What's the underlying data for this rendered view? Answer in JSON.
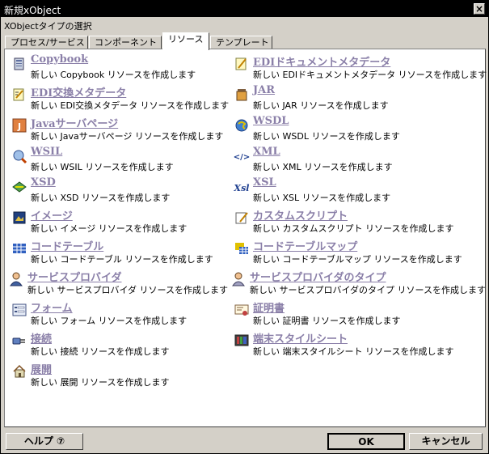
{
  "window": {
    "title": "新規xObject",
    "close_label": "×",
    "subtitle": "XObjectタイプの選択"
  },
  "tabs": [
    {
      "label": "プロセス/サービス"
    },
    {
      "label": "コンポーネント"
    },
    {
      "label": "リソース"
    },
    {
      "label": "テンプレート"
    }
  ],
  "active_tab": "リソース",
  "items": [
    {
      "name": "Copybook",
      "desc": "新しい Copybook リソースを作成します",
      "icon": "copybook-icon"
    },
    {
      "name": "EDIドキュメントメタデータ",
      "desc": "新しい EDIドキュメントメタデータ リソースを作成します",
      "icon": "edi-document-icon"
    },
    {
      "name": "EDI交換メタデータ",
      "desc": "新しい EDI交換メタデータ リソースを作成します",
      "icon": "edi-exchange-icon"
    },
    {
      "name": "JAR",
      "desc": "新しい JAR リソースを作成します",
      "icon": "jar-icon"
    },
    {
      "name": "Javaサーバページ",
      "desc": "新しい Javaサーバページ リソースを作成します",
      "icon": "jsp-icon"
    },
    {
      "name": "WSDL",
      "desc": "新しい WSDL リソースを作成します",
      "icon": "wsdl-icon"
    },
    {
      "name": "WSIL",
      "desc": "新しい WSIL リソースを作成します",
      "icon": "wsil-icon"
    },
    {
      "name": "XML",
      "desc": "新しい XML リソースを作成します",
      "icon": "xml-icon"
    },
    {
      "name": "XSD",
      "desc": "新しい XSD リソースを作成します",
      "icon": "xsd-icon"
    },
    {
      "name": "XSL",
      "desc": "新しい XSL リソースを作成します",
      "icon": "xsl-icon"
    },
    {
      "name": "イメージ",
      "desc": "新しい イメージ リソースを作成します",
      "icon": "image-icon"
    },
    {
      "name": "カスタムスクリプト",
      "desc": "新しい カスタムスクリプト リソースを作成します",
      "icon": "custom-script-icon"
    },
    {
      "name": "コードテーブル",
      "desc": "新しい コードテーブル リソースを作成します",
      "icon": "code-table-icon"
    },
    {
      "name": "コードテーブルマップ",
      "desc": "新しい コードテーブルマップ リソースを作成します",
      "icon": "code-table-map-icon"
    },
    {
      "name": "サービスプロバイダ",
      "desc": "新しい サービスプロバイダ リソースを作成します",
      "icon": "service-provider-icon"
    },
    {
      "name": "サービスプロバイダのタイプ",
      "desc": "新しい サービスプロバイダのタイプ リソースを作成します",
      "icon": "service-provider-type-icon"
    },
    {
      "name": "フォーム",
      "desc": "新しい フォーム リソースを作成します",
      "icon": "form-icon"
    },
    {
      "name": "証明書",
      "desc": "新しい 証明書 リソースを作成します",
      "icon": "certificate-icon"
    },
    {
      "name": "接続",
      "desc": "新しい 接続 リソースを作成します",
      "icon": "connection-icon"
    },
    {
      "name": "端末スタイルシート",
      "desc": "新しい 端末スタイルシート リソースを作成します",
      "icon": "terminal-stylesheet-icon"
    },
    {
      "name": "展開",
      "desc": "新しい 展開 リソースを作成します",
      "icon": "deployment-icon"
    }
  ],
  "footer": {
    "help_label": "ヘルプ ⑦",
    "ok_label": "OK",
    "cancel_label": "キャンセル"
  }
}
